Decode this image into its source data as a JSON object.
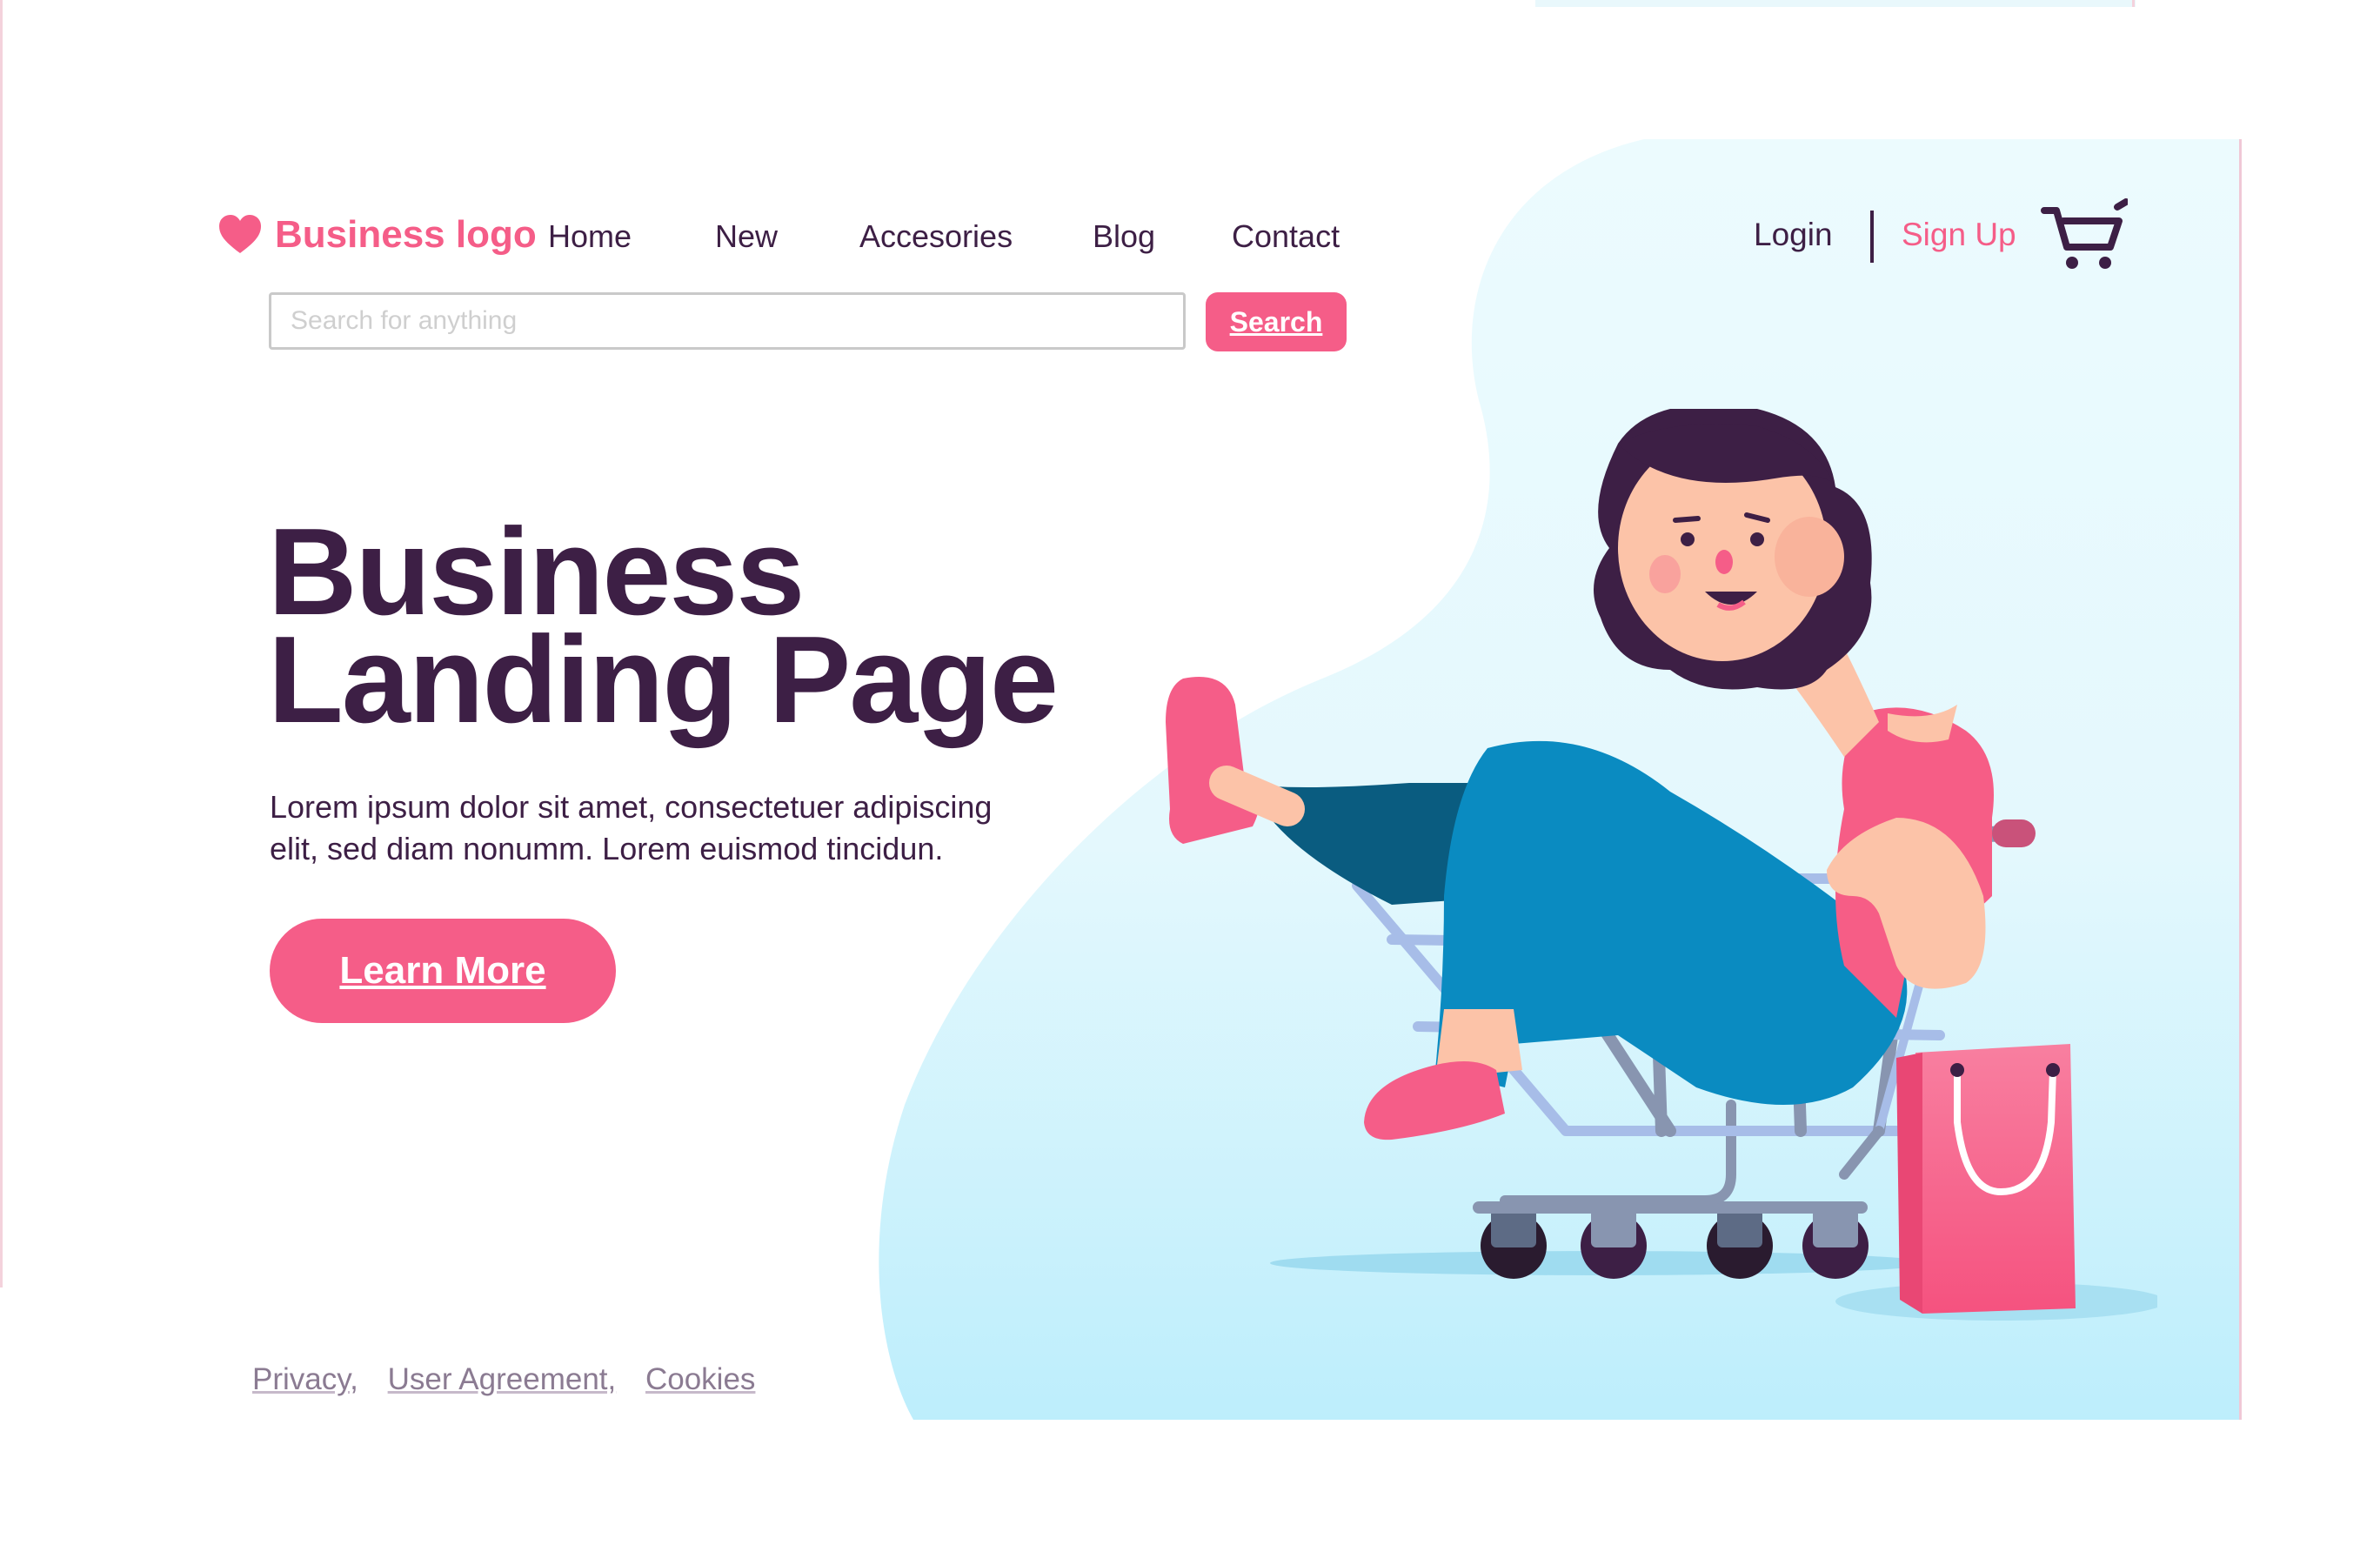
{
  "brand": {
    "logo_text": "Business logo",
    "logo_icon": "heart-icon"
  },
  "nav": {
    "items": [
      {
        "label": "Home"
      },
      {
        "label": "New"
      },
      {
        "label": "Accesories"
      },
      {
        "label": "Blog"
      },
      {
        "label": "Contact"
      }
    ]
  },
  "auth": {
    "login_label": "Login",
    "signup_label": "Sign Up",
    "cart_icon": "cart-icon"
  },
  "search": {
    "placeholder": "Search for anything",
    "value": "",
    "button_label": "Search"
  },
  "hero": {
    "title_line1": "Business",
    "title_line2": "Landing Page",
    "description_line1": "Lorem ipsum dolor sit amet, consectetuer adipiscing",
    "description_line2": "elit, sed diam nonumm. Lorem euismod tincidun.",
    "cta_label": "Learn More"
  },
  "footer": {
    "links": [
      {
        "label": "Privacy,"
      },
      {
        "label": "User Agreement,"
      },
      {
        "label": "Cookies"
      }
    ]
  },
  "colors": {
    "brand_pink": "#f55d88",
    "dark_purple": "#3d1f45",
    "hero_blue_light": "#e9fafe",
    "hero_blue": "#bdeefc",
    "footer_gray": "#8b7b92"
  }
}
